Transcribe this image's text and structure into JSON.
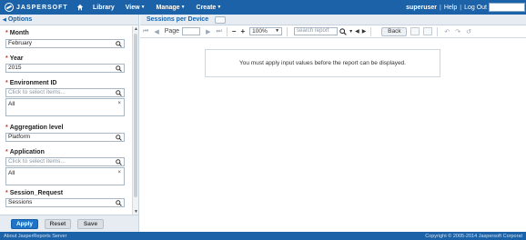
{
  "header": {
    "brand": "JASPERSOFT",
    "nav": [
      {
        "label": "Library"
      },
      {
        "label": "View"
      },
      {
        "label": "Manage"
      },
      {
        "label": "Create"
      }
    ],
    "user": "superuser",
    "help": "Help",
    "logout": "Log Out"
  },
  "options": {
    "title": "Options",
    "params": [
      {
        "label": "Month",
        "value": "February",
        "kind": "text"
      },
      {
        "label": "Year",
        "value": "2015",
        "kind": "text"
      },
      {
        "label": "Environment ID",
        "placeholder": "Click to select items...",
        "selected": "All",
        "kind": "multi"
      },
      {
        "label": "Aggregation level",
        "value": "Platform",
        "kind": "text"
      },
      {
        "label": "Application",
        "placeholder": "Click to select items...",
        "selected": "All",
        "kind": "multi"
      },
      {
        "label": "Session_Request",
        "value": "Sessions",
        "kind": "text"
      }
    ],
    "buttons": {
      "apply": "Apply",
      "reset": "Reset",
      "save": "Save"
    }
  },
  "report": {
    "title": "Sessions per Device",
    "page_label": "Page",
    "zoom": "100%",
    "search_placeholder": "search report",
    "back_label": "Back",
    "message": "You must apply input values before the report can be displayed."
  },
  "footer": {
    "left": "About JasperReports Server",
    "right": "Copyright © 2005-2014 Jaspersoft Corporat"
  },
  "colors": {
    "brand_blue": "#1b62a8",
    "required": "#c43c23",
    "apply_button": "#1f74c8"
  },
  "icons": [
    "logo-icon",
    "home-icon",
    "search-icon",
    "multi-select-icon",
    "clear-icon",
    "refresh-icon",
    "undo-icon",
    "redo-icon",
    "export-icon"
  ]
}
